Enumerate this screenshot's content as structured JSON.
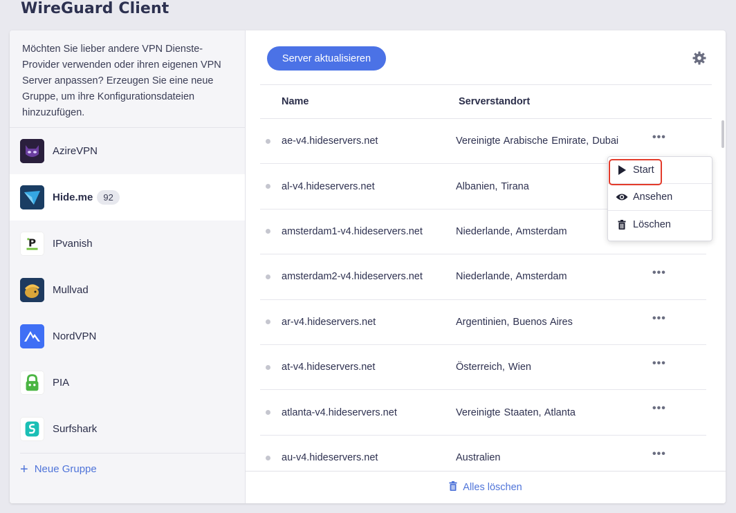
{
  "app": {
    "title": "WireGuard Client"
  },
  "sidebar": {
    "intro": "Möchten Sie lieber andere VPN Dienste-Provider verwenden oder ihren eigenen VPN Server anpassen? Erzeugen Sie eine neue Gruppe, um ihre Konfigurationsdateien hinzuzufügen.",
    "groups": [
      {
        "label": "AzireVPN",
        "icon": "azirevpn-logo-icon",
        "color": "#2a1f3d"
      },
      {
        "label": "Hide.me",
        "icon": "hideme-logo-icon",
        "color": "#1a3d63",
        "count": "92",
        "active": true
      },
      {
        "label": "IPvanish",
        "icon": "ipvanish-logo-icon",
        "color": "#ffffff"
      },
      {
        "label": "Mullvad",
        "icon": "mullvad-logo-icon",
        "color": "#1e3a5f"
      },
      {
        "label": "NordVPN",
        "icon": "nordvpn-logo-icon",
        "color": "#3f6ff5"
      },
      {
        "label": "PIA",
        "icon": "pia-logo-icon",
        "color": "#4bb543"
      },
      {
        "label": "Surfshark",
        "icon": "surfshark-logo-icon",
        "color": "#1bbfb5"
      }
    ],
    "new_group": "Neue Gruppe"
  },
  "main": {
    "refresh_label": "Server aktualisieren",
    "settings_icon": "gear-icon",
    "columns": {
      "name": "Name",
      "location": "Serverstandort"
    },
    "servers": [
      {
        "name": "ae-v4.hideservers.net",
        "location": "Vereinigte Arabische Emirate, Dubai"
      },
      {
        "name": "al-v4.hideservers.net",
        "location": "Albanien, Tirana"
      },
      {
        "name": "amsterdam1-v4.hideservers.net",
        "location": "Niederlande, Amsterdam"
      },
      {
        "name": "amsterdam2-v4.hideservers.net",
        "location": "Niederlande, Amsterdam"
      },
      {
        "name": "ar-v4.hideservers.net",
        "location": "Argentinien, Buenos Aires"
      },
      {
        "name": "at-v4.hideservers.net",
        "location": "Österreich, Wien"
      },
      {
        "name": "atlanta-v4.hideservers.net",
        "location": "Vereinigte Staaten, Atlanta"
      },
      {
        "name": "au-v4.hideservers.net",
        "location": "Australien"
      }
    ],
    "clear_all": "Alles löschen"
  },
  "context_menu": {
    "items": [
      {
        "label": "Start",
        "icon": "play-icon"
      },
      {
        "label": "Ansehen",
        "icon": "eye-icon"
      },
      {
        "label": "Löschen",
        "icon": "trash-icon"
      }
    ]
  },
  "colors": {
    "accent": "#4b72e6",
    "link": "#4f74d9",
    "highlight": "#e33b2b"
  }
}
